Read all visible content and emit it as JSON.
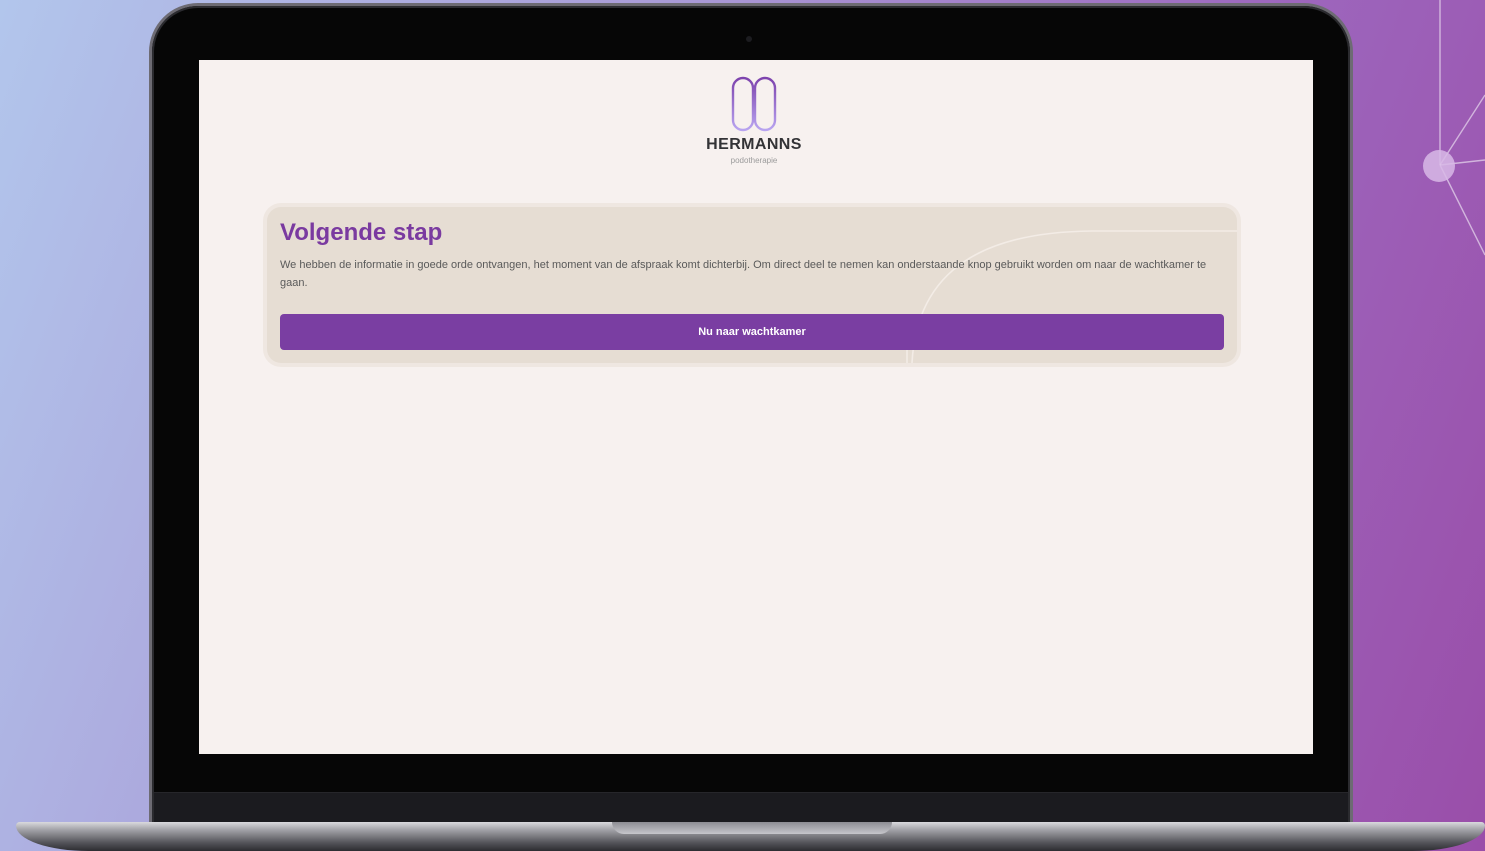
{
  "brand": {
    "name": "HERMANNS",
    "subtitle": "podotherapie",
    "logo_icon": "hermanns-logo-icon"
  },
  "card": {
    "title": "Volgende stap",
    "text": "We hebben de informatie in goede orde ontvangen, het moment van de afspraak komt dichterbij. Om direct deel te nemen kan onderstaande knop gebruikt worden om naar de wachtkamer te gaan.",
    "button_label": "Nu naar wachtkamer"
  },
  "colors": {
    "accent": "#7a3ea2",
    "title": "#7a3aa0",
    "card_background": "#e6ddd3",
    "screen_background": "#f7f1ef"
  }
}
